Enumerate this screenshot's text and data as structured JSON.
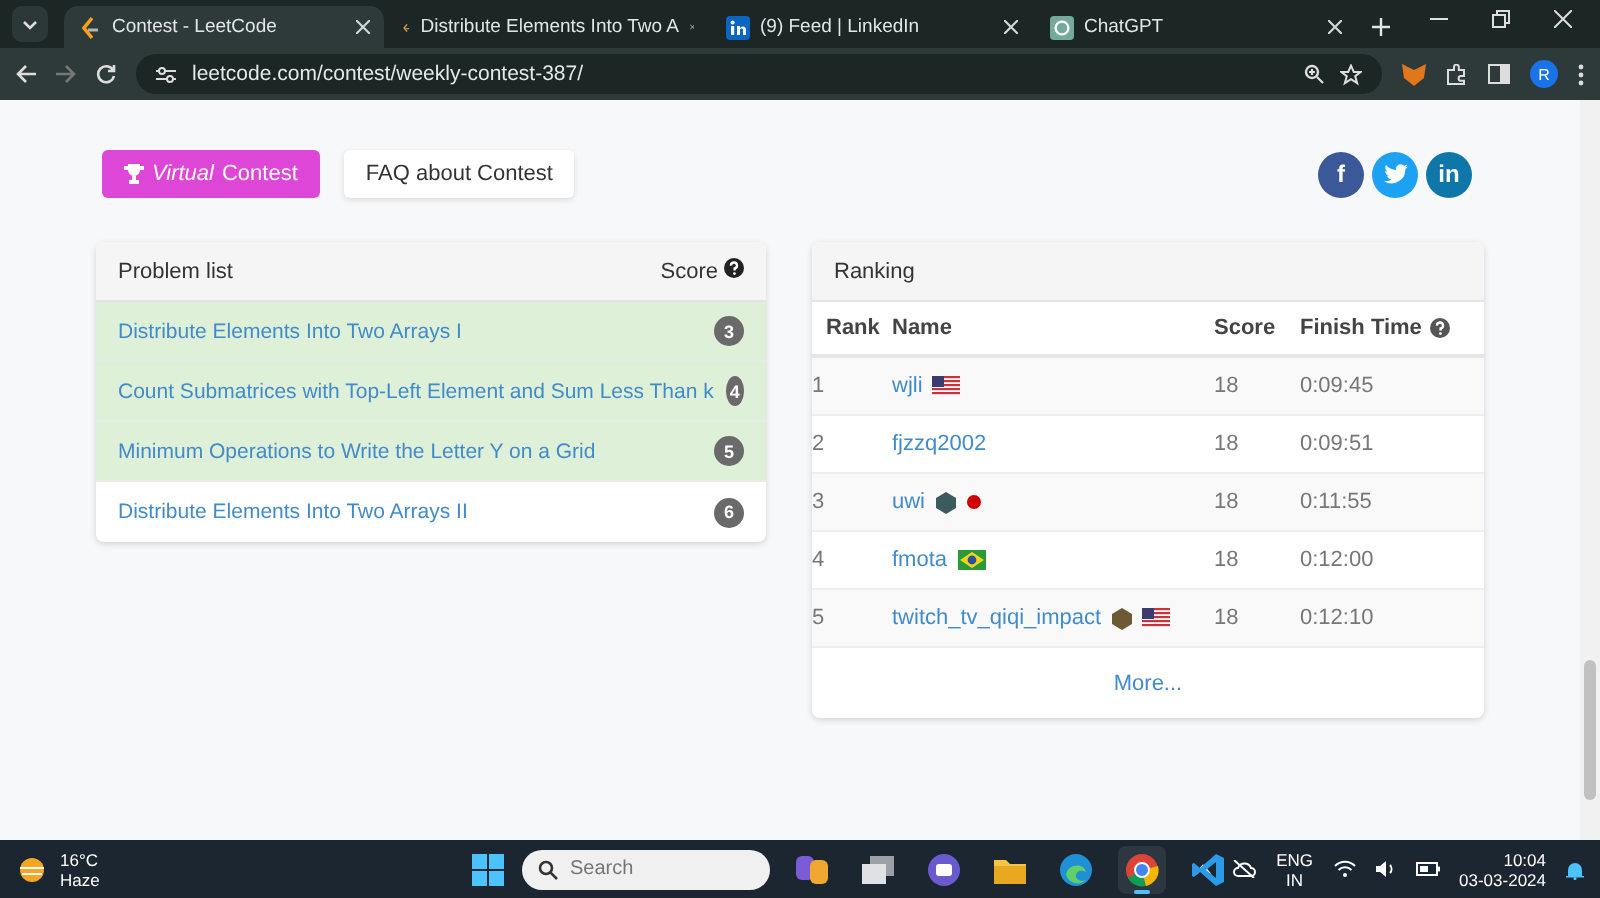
{
  "browser": {
    "tabs": [
      {
        "kind": "leetcode",
        "title": "Contest - LeetCode",
        "selected": true
      },
      {
        "kind": "leetcode",
        "title": "Distribute Elements Into Two A",
        "selected": false
      },
      {
        "kind": "linkedin",
        "title": "(9) Feed | LinkedIn",
        "selected": false
      },
      {
        "kind": "chatgpt",
        "title": "ChatGPT",
        "selected": false
      }
    ],
    "address": "leetcode.com/contest/weekly-contest-387/",
    "profile_initial": "R"
  },
  "actions": {
    "virtual_prefix": "Virtual",
    "virtual_label": "Contest",
    "faq": "FAQ about Contest"
  },
  "social": [
    {
      "kind": "facebook",
      "text": "f"
    },
    {
      "kind": "twitter"
    },
    {
      "kind": "linkedin",
      "text": "in"
    }
  ],
  "problem_list": {
    "title": "Problem list",
    "score_header": "Score",
    "problems": [
      {
        "title": "Distribute Elements Into Two Arrays I",
        "score": "3",
        "solved": true
      },
      {
        "title": "Count Submatrices with Top-Left Element and Sum Less Than k",
        "score": "4",
        "solved": true
      },
      {
        "title": "Minimum Operations to Write the Letter Y on a Grid",
        "score": "5",
        "solved": true
      },
      {
        "title": "Distribute Elements Into Two Arrays II",
        "score": "6",
        "solved": false
      }
    ]
  },
  "ranking": {
    "title": "Ranking",
    "columns": [
      "Rank",
      "Name",
      "Score",
      "Finish Time"
    ],
    "rows": [
      {
        "rank": "1",
        "name": "wjli",
        "marks": [
          {
            "kind": "flag_us"
          }
        ],
        "score": "18",
        "finish_time": "0:09:45"
      },
      {
        "rank": "2",
        "name": "fjzzq2002",
        "marks": [],
        "score": "18",
        "finish_time": "0:09:51"
      },
      {
        "rank": "3",
        "name": "uwi",
        "marks": [
          {
            "kind": "gem"
          },
          {
            "kind": "flag_jp"
          }
        ],
        "score": "18",
        "finish_time": "0:11:55"
      },
      {
        "rank": "4",
        "name": "fmota",
        "marks": [
          {
            "kind": "flag_br"
          }
        ],
        "score": "18",
        "finish_time": "0:12:00"
      },
      {
        "rank": "5",
        "name": "twitch_tv_qiqi_impact",
        "marks": [
          {
            "kind": "gem_gold"
          },
          {
            "kind": "flag_us"
          }
        ],
        "score": "18",
        "finish_time": "0:12:10"
      }
    ],
    "more": "More..."
  },
  "taskbar": {
    "temperature": "16°C",
    "weather": "Haze",
    "search_placeholder": "Search",
    "apps": [
      {
        "kind": "copilot",
        "selected": false
      },
      {
        "kind": "taskview",
        "selected": false
      },
      {
        "kind": "chat",
        "selected": false
      },
      {
        "kind": "folder",
        "selected": false
      },
      {
        "kind": "edge",
        "selected": false
      },
      {
        "kind": "chrome",
        "selected": true
      },
      {
        "kind": "vscode",
        "selected": false
      }
    ],
    "language": "ENG",
    "region": "IN",
    "time": "10:04",
    "date": "03-03-2024"
  }
}
